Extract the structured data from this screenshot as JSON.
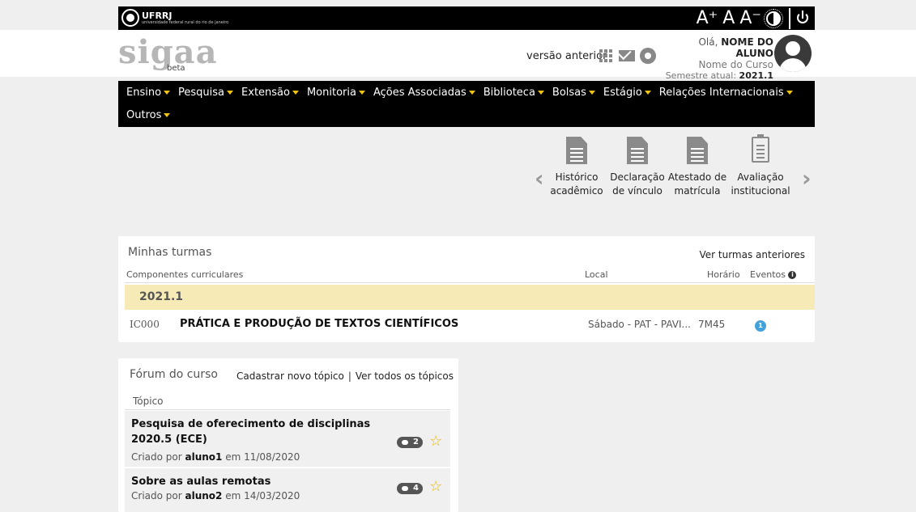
{
  "topbar": {
    "logo_text": "UFRRJ",
    "logo_sub": "universidade federal rural do rio de janeiro",
    "font_increase": "A⁺",
    "font_normal": "A",
    "font_decrease": "A⁻"
  },
  "header": {
    "brand": "sigaa",
    "brand_beta": "beta",
    "previous_version": "versão anterior",
    "greeting": "Olá,",
    "user_name": "NOME DO ALUNO",
    "course": "Nome do Curso",
    "semester_label": "Semestre atual:",
    "semester_value": "2021.1"
  },
  "menu": {
    "row1": [
      "Ensino",
      "Pesquisa",
      "Extensão",
      "Monitoria",
      "Ações Associadas",
      "Biblioteca",
      "Bolsas",
      "Estágio",
      "Relações Internacionais"
    ],
    "row2": [
      "Outros"
    ]
  },
  "shortcuts": [
    {
      "line1": "Histórico",
      "line2": "acadêmico",
      "icon": "document-icon"
    },
    {
      "line1": "Declaração",
      "line2": "de vínculo",
      "icon": "document-icon"
    },
    {
      "line1": "Atestado de",
      "line2": "matrícula",
      "icon": "document-icon"
    },
    {
      "line1": "Avaliação",
      "line2": "institucional",
      "icon": "clipboard-icon"
    }
  ],
  "turmas": {
    "title": "Minhas turmas",
    "previous_link": "Ver turmas anteriores",
    "columns": {
      "componentes": "Componentes curriculares",
      "local": "Local",
      "horario": "Horário",
      "eventos": "Eventos"
    },
    "semester": "2021.1",
    "rows": [
      {
        "code": "IC000",
        "name": "PRÁTICA E PRODUÇÃO DE TEXTOS CIENTÍFICOS",
        "local": "Sábado - PAT - PAVI...",
        "horario": "7M45",
        "eventos": "1"
      }
    ]
  },
  "forum": {
    "title": "Fórum do curso",
    "new_topic": "Cadastrar novo tópico",
    "separator": "|",
    "all_topics": "Ver todos os tópicos",
    "column": "Tópico",
    "topics": [
      {
        "title": "Pesquisa de oferecimento de disciplinas 2020.5 (ECE)",
        "by_label": "Criado por",
        "author": "aluno1",
        "date_label": "em 11/08/2020",
        "count": "2"
      },
      {
        "title": "Sobre as aulas remotas",
        "by_label": "Criado por",
        "author": "aluno2",
        "date_label": "em 14/03/2020",
        "count": "4"
      }
    ]
  },
  "colors": {
    "menu_bg": "#000000",
    "menu_caret": "#f1c40f",
    "semester_band": "#f6eab7",
    "event_badge": "#45a2d9",
    "star": "#e6b800"
  }
}
